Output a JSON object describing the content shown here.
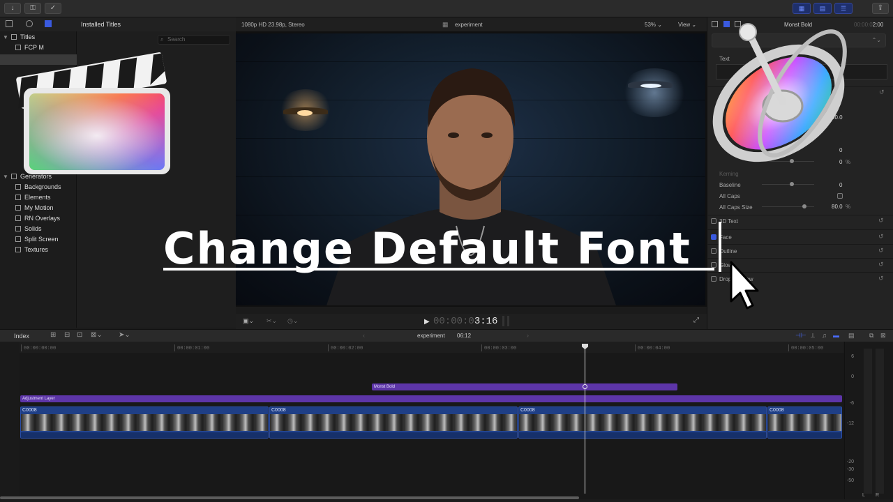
{
  "headline": "Change Default Font",
  "toolbar": {
    "icons": [
      "download-icon",
      "key-icon",
      "checkmark-icon"
    ],
    "right_icons": [
      "grid-layout-icon",
      "list-layout-icon",
      "sliders-icon",
      "share-icon"
    ]
  },
  "library": {
    "header": "Installed Titles",
    "search_placeholder": "Search",
    "items": [
      {
        "label": "Titles",
        "level": 0,
        "expanded": true
      },
      {
        "label": "FCP M",
        "level": 1
      },
      {
        "label": "Generators",
        "level": 0,
        "expanded": true
      },
      {
        "label": "Backgrounds",
        "level": 1
      },
      {
        "label": "Elements",
        "level": 1
      },
      {
        "label": "My Motion",
        "level": 1
      },
      {
        "label": "RN Overlays",
        "level": 1
      },
      {
        "label": "Solids",
        "level": 1
      },
      {
        "label": "Split Screen",
        "level": 1
      },
      {
        "label": "Textures",
        "level": 1
      }
    ]
  },
  "viewer": {
    "format": "1080p HD 23.98p, Stereo",
    "project": "experiment",
    "zoom": "53%",
    "view_menu": "View",
    "timecode_dim": "00:00:0",
    "timecode_bright": "3:16"
  },
  "inspector": {
    "clip_name": "Monst Bold",
    "duration_dim": "00:00:0",
    "duration_bright": "2:00",
    "text_label": "Text",
    "value_90": "90.0",
    "value_0a": "0",
    "value_0pct": "0",
    "kerning_label": "Kerning",
    "baseline_label": "Baseline",
    "baseline_value": "0",
    "allcaps_label": "All Caps",
    "allcaps_size_label": "All Caps Size",
    "allcaps_size_value": "80.0",
    "pct": "%",
    "sections": [
      {
        "label": "3D Text",
        "checked": false
      },
      {
        "label": "Face",
        "checked": true
      },
      {
        "label": "Outline",
        "checked": false
      },
      {
        "label": "Glow",
        "checked": false
      },
      {
        "label": "Drop Shadow",
        "checked": false
      }
    ]
  },
  "timeline": {
    "index_label": "Index",
    "project": "experiment",
    "duration": "06:12",
    "ruler": [
      "00:00:00:00",
      "00:00:01:00",
      "00:00:02:00",
      "00:00:03:00",
      "00:00:04:00",
      "00:00:05:00"
    ],
    "title_clip": "Monst Bold",
    "adjustment_clip": "Adjustment Layer",
    "video_clips": [
      "C0008",
      "C0008",
      "C0008",
      "C0008"
    ],
    "meter_scale": [
      "6",
      "0",
      "-6",
      "-12",
      "-20",
      "-30",
      "-50"
    ],
    "meter_channels": [
      "L",
      "R"
    ]
  },
  "colors": {
    "accent": "#3a5adf",
    "title_clip": "#5d35a8",
    "video_clip": "#1f3f86"
  }
}
